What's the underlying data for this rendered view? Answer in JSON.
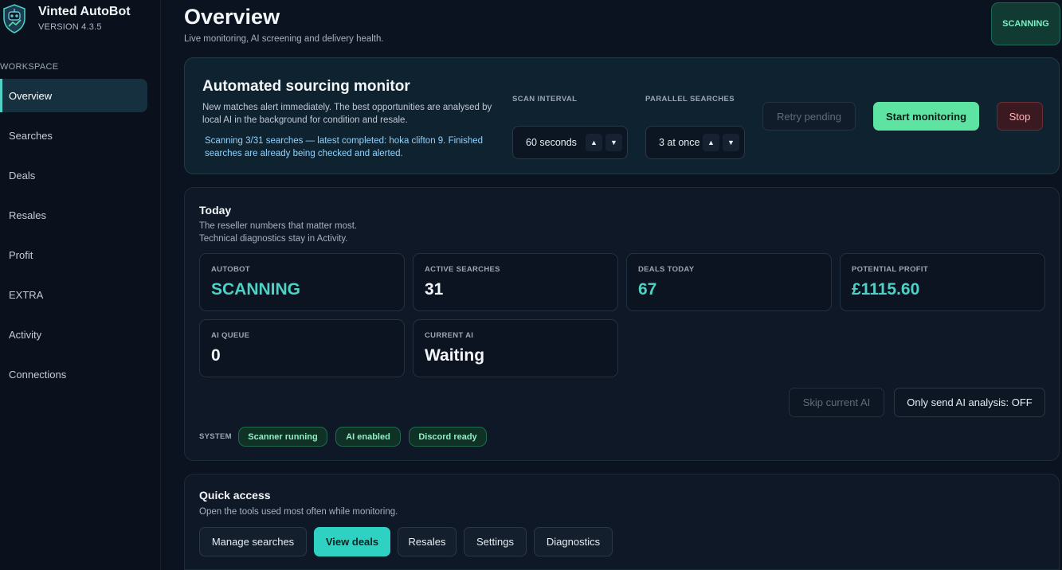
{
  "app": {
    "title": "Vinted AutoBot",
    "version": "VERSION 4.3.5"
  },
  "sidebar": {
    "section_label": "WORKSPACE",
    "items": [
      {
        "label": "Overview",
        "active": true
      },
      {
        "label": "Searches"
      },
      {
        "label": "Deals"
      },
      {
        "label": "Resales"
      },
      {
        "label": "Profit"
      },
      {
        "label": "EXTRA"
      },
      {
        "label": "Activity"
      },
      {
        "label": "Connections"
      }
    ]
  },
  "header": {
    "title": "Overview",
    "subtitle": "Live monitoring, AI screening and delivery health.",
    "status": "SCANNING"
  },
  "monitor": {
    "title": "Automated sourcing monitor",
    "description": "New matches alert immediately. The best opportunities are analysed by local AI in the background for condition and resale.",
    "status_text": "Scanning 3/31 searches — latest completed: hoka clifton 9. Finished searches are already being checked and alerted.",
    "scan_interval": {
      "label": "SCAN INTERVAL",
      "value": "60 seconds"
    },
    "parallel": {
      "label": "PARALLEL SEARCHES",
      "value": "3 at once"
    },
    "retry_label": "Retry pending",
    "start_label": "Start monitoring",
    "stop_label": "Stop"
  },
  "today": {
    "title": "Today",
    "subtitle_1": "The reseller numbers that matter most.",
    "subtitle_2": "Technical diagnostics stay in Activity.",
    "metrics": [
      {
        "label": "AUTOBOT",
        "value": "SCANNING"
      },
      {
        "label": "ACTIVE SEARCHES",
        "value": "31"
      },
      {
        "label": "DEALS TODAY",
        "value": "67"
      },
      {
        "label": "POTENTIAL PROFIT",
        "value": "£1115.60"
      },
      {
        "label": "AI QUEUE",
        "value": "0"
      },
      {
        "label": "CURRENT AI",
        "value": "Waiting"
      }
    ],
    "skip_label": "Skip current AI",
    "only_send_label": "Only send AI analysis: OFF",
    "system_label": "SYSTEM",
    "badges": [
      "Scanner running",
      "AI enabled",
      "Discord ready"
    ]
  },
  "quick": {
    "title": "Quick access",
    "subtitle": "Open the tools used most often while monitoring.",
    "buttons": [
      "Manage searches",
      "View deals",
      "Resales",
      "Settings",
      "Diagnostics"
    ]
  },
  "colors": {
    "accent": "#4fd1c5",
    "success": "#5ee4a2",
    "danger": "#ffb3b8",
    "background": "#0b1320"
  }
}
